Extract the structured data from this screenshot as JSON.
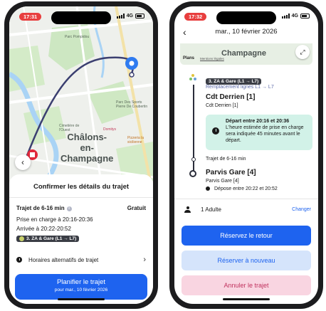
{
  "left_phone": {
    "status": {
      "time": "17:31",
      "network": "4G"
    },
    "map": {
      "city": [
        "Châlons-",
        "en-",
        "Champagne"
      ],
      "labels": {
        "pompidou": "Parc Pompidou",
        "coubertin": "Parc Des Sports Pierre De Coubertin",
        "domitys": "Domitys",
        "sicilienne": "Pizzeria la sicilienne",
        "cimetiere": "Cimetière de l'Ouest"
      }
    },
    "sheet": {
      "title": "Confirmer les détails du trajet",
      "trip_label": "Trajet de 6-16 min",
      "price": "Gratuit",
      "pickup": "Prise en charge à 20:16-20:36",
      "arrival": "Arrivée à 20:22-20:52",
      "route": "3. ZA & Gare (L1 → L7)",
      "alt_schedules": "Horaires alternatifs de trajet",
      "plan_button": "Planifier le trajet",
      "plan_sub": "pour mar., 10 février 2026"
    }
  },
  "right_phone": {
    "status": {
      "time": "17:32",
      "network": "4G"
    },
    "header": {
      "title": "mar., 10 février 2026"
    },
    "map": {
      "city": "Champagne",
      "provider": "Plans",
      "legal": "Mentions légales"
    },
    "route": "3. ZA & Gare (L1 → L7)",
    "replacement": "Remplacement lignes L1 → L7",
    "stop1": {
      "name": "Cdt Derrien [1]",
      "sub": "Cdt Derrien [1]"
    },
    "info": {
      "title": "Départ entre 20:16 et 20:36",
      "body": "L'heure estimée de prise en charge sera indiquée 45 minutes avant le départ."
    },
    "duration": "Trajet de 6-16 min",
    "stop2": {
      "name": "Parvis Gare [4]",
      "sub": "Parvis Gare [4]"
    },
    "dropoff": "Dépose entre 20:22 et 20:52",
    "passengers": "1 Adulte",
    "change": "Changer",
    "buttons": {
      "return": "Réservez le retour",
      "again": "Réserver à nouveau",
      "cancel": "Annuler le trajet"
    }
  },
  "colors": {
    "primary": "#1e63ef",
    "status_red": "#e83e3e",
    "info_bg": "#d2f2e8",
    "cancel_bg": "#f9d5e1",
    "again_bg": "#d5e4fb",
    "route_line": "#3b3f70"
  },
  "icons": [
    "clock-icon",
    "chevron-right-icon",
    "back-arrow-icon",
    "person-icon",
    "bus-icon",
    "expand-icon",
    "info-icon"
  ]
}
